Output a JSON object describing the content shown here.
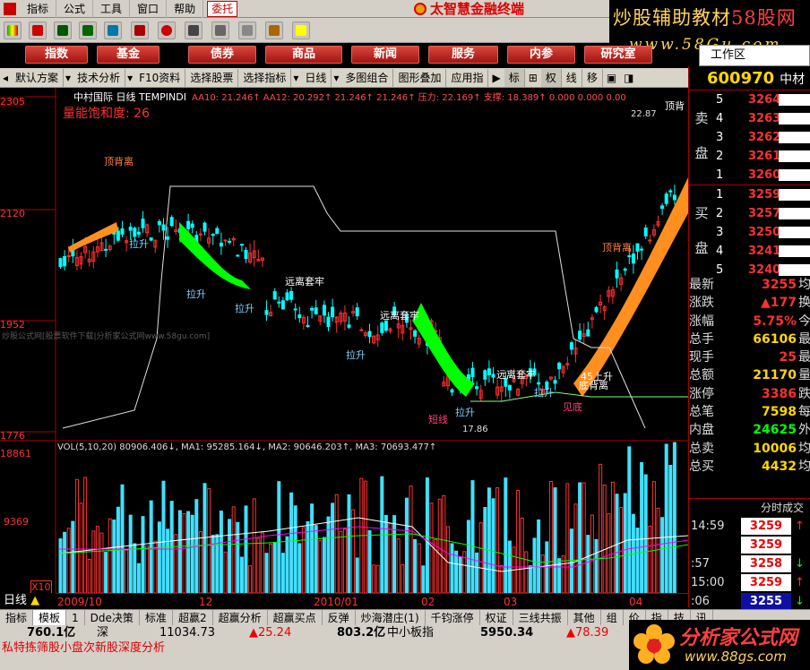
{
  "menu": {
    "items": [
      "指标",
      "公式",
      "工具",
      "窗口",
      "帮助"
    ],
    "entrust": "委托",
    "brand": "太智慧金融终端"
  },
  "watermark": {
    "line1a": "炒股辅助教材",
    "line1b": "58股网",
    "line2": "www.58Gu.com"
  },
  "nav": {
    "buttons": [
      "指数",
      "基金",
      "债券",
      "商品",
      "新闻",
      "服务",
      "内参",
      "研究室"
    ],
    "workspace": "工作区"
  },
  "func_toolbar": [
    "默认方案",
    "技术分析",
    "F10资料",
    "选择股票",
    "选择指标",
    "日线",
    "多图组合",
    "图形叠加",
    "应用指",
    "标",
    "权",
    "线",
    "移"
  ],
  "chart": {
    "title": "中村国际 日线 TEMPINDI",
    "indicator_line": "AA10: 21.246↑ AA12: 20.292↑ 21.246↑ 21.246↑ 压力: 22.169↑ 支撑: 18.389↑ 0.000 0.000 0.00",
    "energy": "量能饱和度: 26",
    "y_labels": [
      "2305",
      "2120",
      "1952",
      "1776"
    ],
    "vol_y_labels": [
      "18861",
      "9369",
      "X10"
    ],
    "vol_line": "VOL(5,10,20) 80906.406↓, MA1: 95285.164↓, MA2: 90646.203↑, MA3: 70693.477↑",
    "x_labels": [
      "2009/10",
      "12",
      "2010/01",
      "02",
      "03",
      "04"
    ],
    "annotations": [
      {
        "text": "顶背离",
        "color": "#ff8040"
      },
      {
        "text": "拉升",
        "color": "#80d0ff"
      },
      {
        "text": "拉升",
        "color": "#80d0ff"
      },
      {
        "text": "拉升",
        "color": "#80d0ff"
      },
      {
        "text": "远离套牢",
        "color": "#ffffff"
      },
      {
        "text": "远离套牢",
        "color": "#ffffff"
      },
      {
        "text": "拉升",
        "color": "#80d0ff"
      },
      {
        "text": "远离套牢",
        "color": "#ffffff"
      },
      {
        "text": "拉升",
        "color": "#80d0ff"
      },
      {
        "text": "拉升",
        "color": "#80d0ff"
      },
      {
        "text": "短线",
        "color": "#ff4080"
      },
      {
        "text": "顶背离",
        "color": "#ff8040"
      },
      {
        "text": "底背离",
        "color": "#ffffff"
      },
      {
        "text": "45上升",
        "color": "#ffffff"
      },
      {
        "text": "见底",
        "color": "#ff4080"
      },
      {
        "text": "顶背",
        "color": "#ffffff"
      }
    ],
    "peak_label": "22.87",
    "low_label": "17.86",
    "overlay_watermark": "炒股公式网[股票软件下载|分析家公式网www.58gu.com]",
    "period_tag": "日线"
  },
  "quote": {
    "code": "600970",
    "name": "中材",
    "ask": [
      {
        "lv": "5",
        "price": "3264"
      },
      {
        "lv": "4",
        "price": "3263"
      },
      {
        "lv": "3",
        "price": "3262"
      },
      {
        "lv": "2",
        "price": "3261"
      },
      {
        "lv": "1",
        "price": "3260"
      }
    ],
    "bid": [
      {
        "lv": "1",
        "price": "3259"
      },
      {
        "lv": "2",
        "price": "3257"
      },
      {
        "lv": "3",
        "price": "3250"
      },
      {
        "lv": "4",
        "price": "3241"
      },
      {
        "lv": "5",
        "price": "3240"
      }
    ],
    "side_sell": [
      "卖",
      "盘"
    ],
    "side_buy": [
      "买",
      "盘"
    ],
    "stats": [
      {
        "label": "最新",
        "value": "3255",
        "unit": "均",
        "color": "#ff3030"
      },
      {
        "label": "涨跌",
        "value": "▲177",
        "unit": "换",
        "color": "#ff3030"
      },
      {
        "label": "涨幅",
        "value": "5.75%",
        "unit": "今",
        "color": "#ff3030"
      },
      {
        "label": "总手",
        "value": "66106",
        "unit": "最",
        "color": "#ffd700"
      },
      {
        "label": "现手",
        "value": "25",
        "unit": "最",
        "color": "#ff3030"
      },
      {
        "label": "总额",
        "value": "21170",
        "unit": "量",
        "color": "#ffd700"
      },
      {
        "label": "涨停",
        "value": "3386",
        "unit": "跌",
        "color": "#ff3030"
      },
      {
        "label": "总笔",
        "value": "7598",
        "unit": "每",
        "color": "#ffd700"
      },
      {
        "label": "内盘",
        "value": "24625",
        "unit": "外",
        "color": "#00ff00"
      },
      {
        "label": "总卖",
        "value": "10006",
        "unit": "均",
        "color": "#ffd700"
      },
      {
        "label": "总买",
        "value": "4432",
        "unit": "均",
        "color": "#ffd700"
      }
    ],
    "ticks_header": "分时成交",
    "ticks": [
      {
        "time": "14:59",
        "price": "3259",
        "arrow": "↑",
        "dir": "up"
      },
      {
        "time": "",
        "price": "3259",
        "arrow": "",
        "dir": "flat"
      },
      {
        "time": ":57",
        "price": "3258",
        "arrow": "↓",
        "dir": "down"
      },
      {
        "time": "15:00",
        "price": "3259",
        "arrow": "↑",
        "dir": "up"
      },
      {
        "time": ":06",
        "price": "3255",
        "arrow": "↓",
        "dir": "down"
      }
    ]
  },
  "bottom_tabs": [
    "指标",
    "模板",
    "1",
    "Dde决策",
    "标准",
    "超赢2",
    "超赢分析",
    "超赢买点",
    "反弹",
    "炒海潜庄(1)",
    "千钧涨停",
    "权证",
    "三线共振",
    "其他",
    "组",
    "价",
    "指",
    "技",
    "讯"
  ],
  "status": {
    "sh_amount": "760.1亿",
    "sz_label": "深",
    "sz_index": "11034.73",
    "sz_change": "▲25.24",
    "sz_amount": "803.2亿",
    "sme_label": "中小板指",
    "sme_index": "5950.34",
    "sme_change": "▲78.39"
  },
  "ticker": "私特拣筛股小盘次新股深度分析",
  "footer_logo": {
    "name": "分析家公式网",
    "url": "www.88gs.com"
  }
}
